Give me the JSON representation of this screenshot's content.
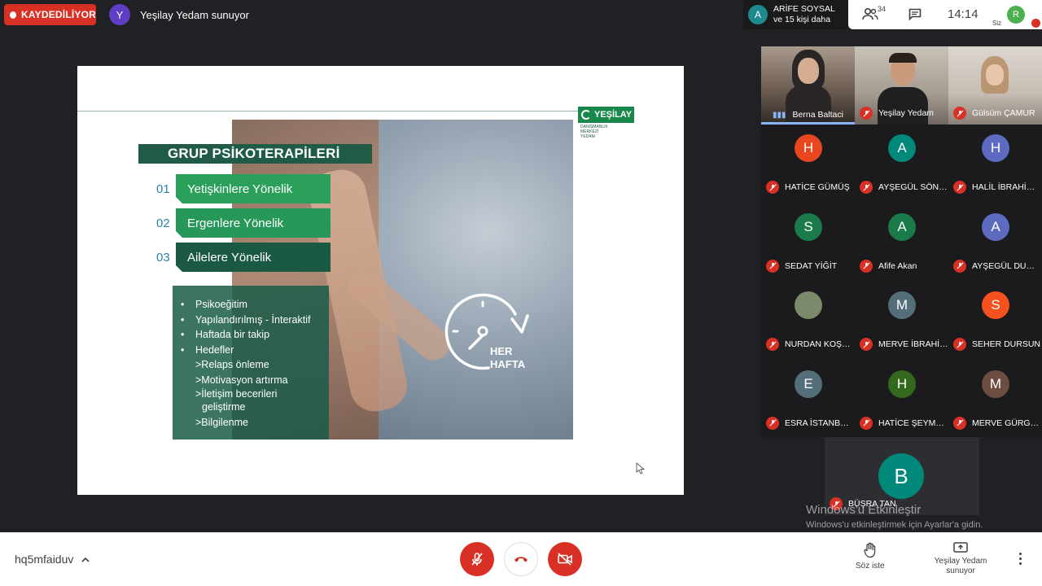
{
  "recording": {
    "label": "KAYDEDİLİYOR"
  },
  "presenter": {
    "initial": "Y",
    "text": "Yeşilay Yedam sunuyor",
    "color": "#5f3dc4"
  },
  "speakers": {
    "initial": "A",
    "line1": "ARİFE SOYSAL",
    "line2": "ve 15 kişi daha"
  },
  "top_right": {
    "people_count": "34",
    "time": "14:14",
    "self_initial": "R",
    "self_label": "Siz"
  },
  "slide": {
    "logo_word": "YEŞİLAY",
    "logo_sub1": "DANIŞMANLIK",
    "logo_sub2": "MERKEZİ",
    "logo_sub3": "YEDAM",
    "heading": "GRUP PSİKOTERAPİLERİ",
    "items": [
      {
        "num": "01",
        "label": "Yetişkinlere Yönelik",
        "color": "#2aa05a"
      },
      {
        "num": "02",
        "label": "Ergenlere Yönelik",
        "color": "#27985a"
      },
      {
        "num": "03",
        "label": "Ailelere Yönelik",
        "color": "#1a5a45"
      }
    ],
    "bullets": [
      "Psikoeğitim",
      "Yapılandırılmış - İnteraktif",
      "Haftada bir takip",
      "Hedefler"
    ],
    "sub_bullets": [
      ">Relaps önleme",
      ">Motivasyon artırma",
      ">İletişim becerileri",
      "geliştirme",
      ">Bilgilenme"
    ],
    "clock_line1": "HER",
    "clock_line2": "HAFTA"
  },
  "video_tiles": [
    {
      "name": "Berna Baltaci",
      "speaking": true
    },
    {
      "name": "Yeşilay Yedam",
      "speaking": false
    },
    {
      "name": "Gülsüm ÇAMUR",
      "speaking": false
    }
  ],
  "participants": [
    {
      "initial": "H",
      "name": "HATİCE GÜMÜŞ",
      "color": "#e8461f"
    },
    {
      "initial": "A",
      "name": "AYŞEGÜL SÖN…",
      "color": "#00897b"
    },
    {
      "initial": "H",
      "name": "HALİL İBRAHİ…",
      "color": "#5c6bc0"
    },
    {
      "initial": "S",
      "name": "SEDAT YİĞİT",
      "color": "#1b7a4a"
    },
    {
      "initial": "A",
      "name": "Afife Akan",
      "color": "#1b7a4a"
    },
    {
      "initial": "A",
      "name": "AYŞEGÜL DU…",
      "color": "#5c6bc0"
    },
    {
      "initial": "",
      "name": "NURDAN KOŞ…",
      "color": "#7a8a6a"
    },
    {
      "initial": "M",
      "name": "MERVE İBRAHİ…",
      "color": "#546e7a"
    },
    {
      "initial": "S",
      "name": "SEHER DURSUN",
      "color": "#f4511e"
    },
    {
      "initial": "E",
      "name": "ESRA İSTANB…",
      "color": "#546e7a"
    },
    {
      "initial": "H",
      "name": "HATİCE ŞEYM…",
      "color": "#33691e"
    },
    {
      "initial": "M",
      "name": "MERVE GÜRG…",
      "color": "#6d4c41"
    }
  ],
  "featured": {
    "initial": "B",
    "name": "BÜŞRA TAN"
  },
  "windows_activation": {
    "title": "Windows'u Etkinleştir",
    "subtitle": "Windows'u etkinleştirmek için Ayarlar'a gidin."
  },
  "bottom_bar": {
    "meeting_code": "hq5mfaiduv",
    "raise_hand": "Söz iste",
    "present_line1": "Yeşilay Yedam",
    "present_line2": "sunuyor"
  }
}
